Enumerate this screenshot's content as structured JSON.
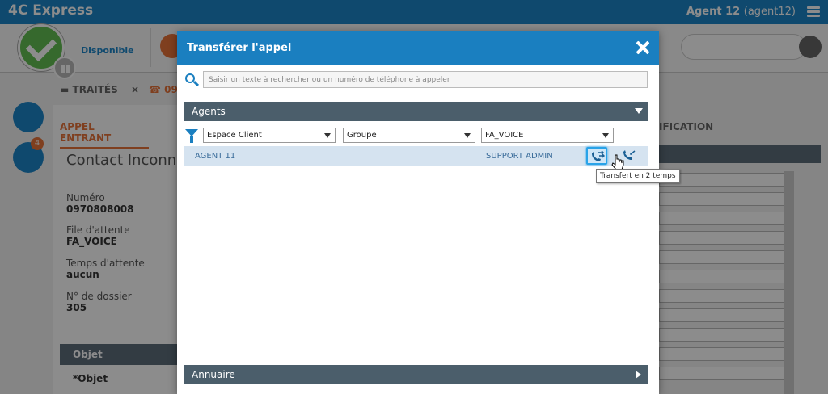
{
  "app": {
    "title": "4C Express",
    "agent_name": "Agent 12",
    "agent_login": "(agent12)"
  },
  "status": {
    "label": "Disponible",
    "color": "#63c052"
  },
  "background": {
    "tabs": [
      {
        "label": "TRAITÉS"
      },
      {
        "label": "09"
      }
    ],
    "panel_title": "APPEL ENTRANT",
    "contact_name": "Contact Inconnu",
    "fields": [
      {
        "label": "Numéro",
        "value": "0970808008"
      },
      {
        "label": "File d'attente",
        "value": "FA_VOICE"
      },
      {
        "label": "Temps d'attente",
        "value": "aucun"
      },
      {
        "label": "N° de dossier",
        "value": "305"
      }
    ],
    "objet_section": "Objet",
    "objet_label": "*Objet",
    "right_tab": "IFICATION",
    "folder_badge": "4"
  },
  "modal": {
    "title": "Transférer l'appel",
    "search_placeholder": "Saisir un texte à rechercher ou un numéro de téléphone à appeler",
    "search_value": "",
    "agents_section": "Agents",
    "annuaire_section": "Annuaire",
    "filters": {
      "espace": "Espace Client",
      "groupe": "Groupe",
      "file": "FA_VOICE"
    },
    "agents": [
      {
        "name": "AGENT 11",
        "group": "SUPPORT ADMIN"
      }
    ],
    "tooltip": "Transfert en 2 temps"
  },
  "colors": {
    "accent": "#1a7fc0",
    "header_bar": "#4b5e6b",
    "brand_orange": "#e8733a",
    "row_highlight": "#d5e3f0"
  }
}
